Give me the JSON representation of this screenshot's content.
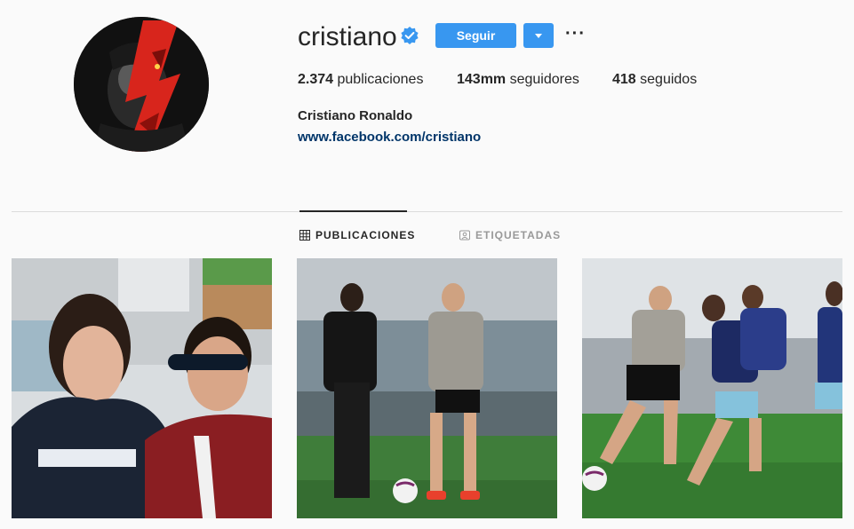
{
  "profile": {
    "username": "cristiano",
    "verified": true,
    "follow_label": "Seguir",
    "more_label": "···",
    "stats": {
      "posts_count": "2.374",
      "posts_label": " publicaciones",
      "followers_count": "143mm",
      "followers_label": " seguidores",
      "following_count": "418",
      "following_label": " seguidos"
    },
    "full_name": "Cristiano Ronaldo",
    "website": "www.facebook.com/cristiano"
  },
  "tabs": [
    {
      "label": "PUBLICACIONES",
      "icon": "grid-icon",
      "active": true
    },
    {
      "label": "ETIQUETADAS",
      "icon": "tagged-icon",
      "active": false
    }
  ],
  "colors": {
    "accent": "#3897f0",
    "link": "#003569",
    "verified": "#3897f0",
    "text": "#262626",
    "muted": "#999999",
    "background": "#fafafa"
  }
}
